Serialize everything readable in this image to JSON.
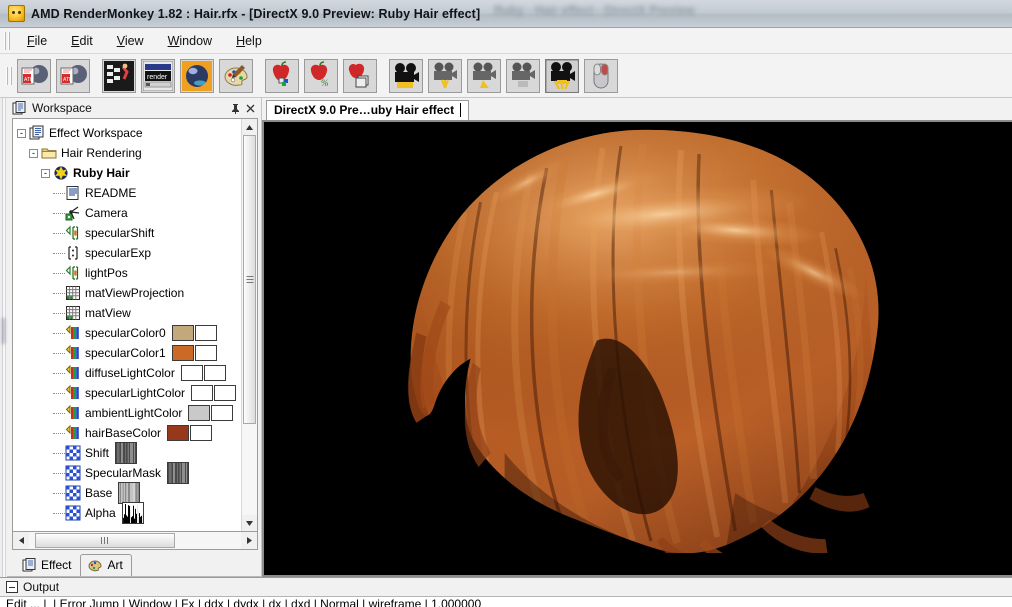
{
  "window": {
    "title": "AMD RenderMonkey 1.82 : Hair.rfx - [DirectX 9.0 Preview: Ruby Hair effect]",
    "title_icon": "monkey-icon",
    "obscured_text": "Ruby  -  Hair effect  -  DirectX Preview"
  },
  "menu": {
    "items": [
      {
        "label": "File",
        "accel": "F"
      },
      {
        "label": "Edit",
        "accel": "E"
      },
      {
        "label": "View",
        "accel": "V"
      },
      {
        "label": "Window",
        "accel": "W"
      },
      {
        "label": "Help",
        "accel": "H"
      }
    ]
  },
  "toolbar": {
    "buttons": [
      {
        "name": "new-effect-workspace-button",
        "icon": "new-document-sphere-icon",
        "pressed": false
      },
      {
        "name": "open-effect-workspace-button",
        "icon": "open-document-sphere-icon",
        "pressed": false
      },
      {
        "name": "effect-tree-button",
        "icon": "effect-tree-icon",
        "pressed": false
      },
      {
        "name": "render-state-button",
        "icon": "render-window-icon",
        "pressed": false
      },
      {
        "name": "preview-sphere-button",
        "icon": "shaded-sphere-icon",
        "pressed": false
      },
      {
        "name": "artist-editor-button",
        "icon": "palette-icon",
        "pressed": false
      },
      {
        "name": "add-variable-button",
        "icon": "apple-variable-icon",
        "pressed": false
      },
      {
        "name": "edit-variable-button",
        "icon": "apple-edit-icon",
        "pressed": false
      },
      {
        "name": "copy-variable-button",
        "icon": "apple-copy-icon",
        "pressed": false
      },
      {
        "name": "camera-button",
        "icon": "camera-icon",
        "pressed": false
      },
      {
        "name": "camera-reset-button",
        "icon": "camera-reset-icon",
        "pressed": false
      },
      {
        "name": "camera-pan-button",
        "icon": "camera-pan-icon",
        "pressed": false
      },
      {
        "name": "camera-zoom-button",
        "icon": "camera-zoom-icon",
        "pressed": false
      },
      {
        "name": "camera-orbit-button",
        "icon": "camera-orbit-icon",
        "pressed": true
      },
      {
        "name": "mouse-mode-button",
        "icon": "mouse-icon",
        "pressed": false
      }
    ]
  },
  "workspace": {
    "panel_title": "Workspace",
    "panel_icon": "workspace-icon",
    "pin_button": "auto-hide-pin",
    "close_button": "close-panel",
    "tree": [
      {
        "label": "Effect Workspace",
        "icon": "workspace-icon",
        "depth": 0,
        "expander": "-",
        "bold": false
      },
      {
        "label": "Hair Rendering",
        "icon": "folder-icon",
        "depth": 1,
        "expander": "-",
        "bold": false
      },
      {
        "label": "Ruby Hair",
        "icon": "effect-icon",
        "depth": 2,
        "expander": "-",
        "bold": true
      },
      {
        "label": "README",
        "icon": "readme-icon",
        "depth": 3,
        "expander": "",
        "bold": false
      },
      {
        "label": "Camera",
        "icon": "camera-node-icon",
        "depth": 3,
        "expander": "",
        "bold": false
      },
      {
        "label": "specularShift",
        "icon": "vector-icon",
        "depth": 3,
        "expander": "",
        "bold": false
      },
      {
        "label": "specularExp",
        "icon": "scalar-icon",
        "depth": 3,
        "expander": "",
        "bold": false
      },
      {
        "label": "lightPos",
        "icon": "vector-icon",
        "depth": 3,
        "expander": "",
        "bold": false
      },
      {
        "label": "matViewProjection",
        "icon": "matrix-icon",
        "depth": 3,
        "expander": "",
        "bold": false
      },
      {
        "label": "matView",
        "icon": "matrix-icon",
        "depth": 3,
        "expander": "",
        "bold": false
      },
      {
        "label": "specularColor0",
        "icon": "color-icon",
        "depth": 3,
        "expander": "",
        "bold": false,
        "swatch": "#c3a87b"
      },
      {
        "label": "specularColor1",
        "icon": "color-icon",
        "depth": 3,
        "expander": "",
        "bold": false,
        "swatch": "#cb6a26"
      },
      {
        "label": "diffuseLightColor",
        "icon": "color-icon",
        "depth": 3,
        "expander": "",
        "bold": false,
        "swatch": "#ffffff"
      },
      {
        "label": "specularLightColor",
        "icon": "color-icon",
        "depth": 3,
        "expander": "",
        "bold": false,
        "swatch": "#ffffff"
      },
      {
        "label": "ambientLightColor",
        "icon": "color-icon",
        "depth": 3,
        "expander": "",
        "bold": false,
        "swatch": "#c9c9c9"
      },
      {
        "label": "hairBaseColor",
        "icon": "color-icon",
        "depth": 3,
        "expander": "",
        "bold": false,
        "swatch": "#98381a"
      },
      {
        "label": "Shift",
        "icon": "texture-icon",
        "depth": 3,
        "expander": "",
        "bold": false,
        "thumb": "noise-gray"
      },
      {
        "label": "SpecularMask",
        "icon": "texture-icon",
        "depth": 3,
        "expander": "",
        "bold": false,
        "thumb": "noise-gray"
      },
      {
        "label": "Base",
        "icon": "texture-icon",
        "depth": 3,
        "expander": "",
        "bold": false,
        "thumb": "noise-light"
      },
      {
        "label": "Alpha",
        "icon": "texture-icon",
        "depth": 3,
        "expander": "",
        "bold": false,
        "thumb": "alpha-black"
      }
    ],
    "vscroll": {
      "up": "▲",
      "down": "▼",
      "thumb_top_pct": 0,
      "thumb_height_pct": 76
    },
    "hscroll": {
      "left": "◄",
      "right": "►"
    },
    "tabs": [
      {
        "label": "Effect",
        "icon": "effect-tab-icon",
        "active": false
      },
      {
        "label": "Art",
        "icon": "art-tab-icon",
        "active": true
      }
    ]
  },
  "preview": {
    "tab_label": "DirectX 9.0 Pre…uby Hair effect",
    "background": "#000000",
    "model": "ruby-hair",
    "hair_colors": {
      "base": "#8a3a15",
      "mid": "#b85a22",
      "highlight": "#e8a05a",
      "spec": "#ffd9a0",
      "shadow": "#3a1707"
    }
  },
  "output": {
    "title": "Output",
    "icon": "output-icon",
    "lines": [
      "Edit ... |_| Error Jump | Window | Fx | ddx | dydx | dx | dxd | Normal | wireframe | 1.000000"
    ]
  }
}
